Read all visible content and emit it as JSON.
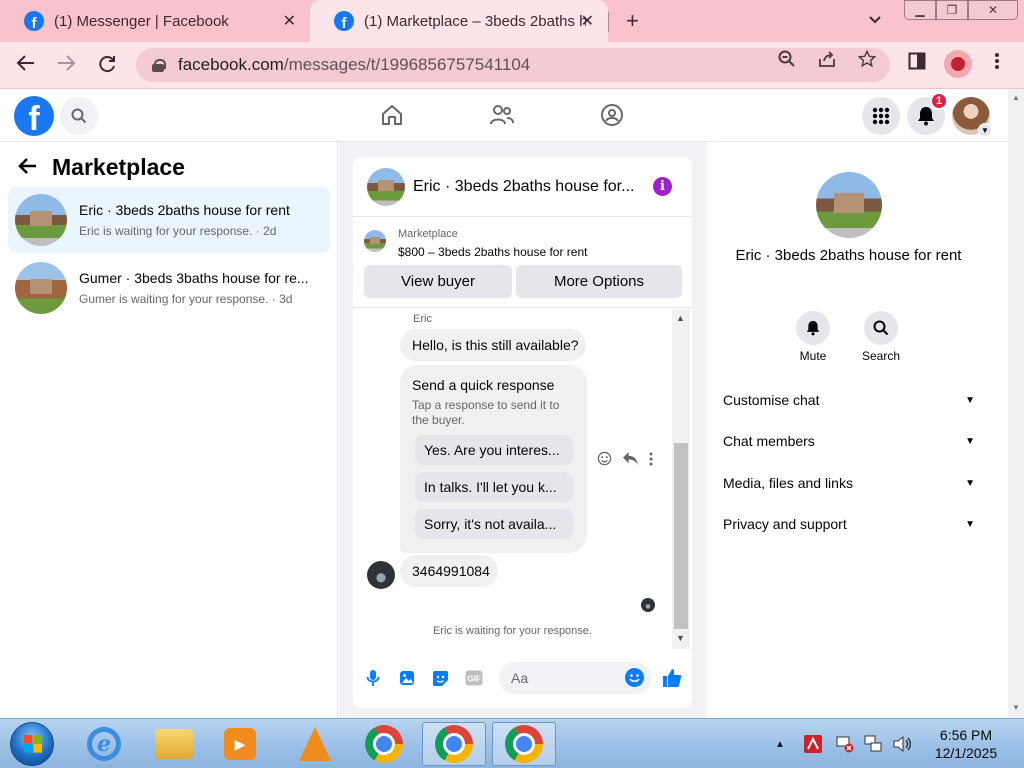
{
  "browser": {
    "tabs": [
      {
        "title": "(1) Messenger | Facebook",
        "close": "✕"
      },
      {
        "title": "(1) Marketplace – 3beds 2baths h",
        "close": "✕"
      }
    ],
    "new_tab": "+",
    "url_domain": "facebook.com",
    "url_path": "/messages/t/1996856757541104"
  },
  "facebook": {
    "logo": "f",
    "notification_count": "1"
  },
  "left": {
    "title": "Marketplace",
    "conversations": [
      {
        "name": "Eric · 3beds 2baths house for rent",
        "sub": "Eric is waiting for your response. · 2d"
      },
      {
        "name": "Gumer · 3beds 3baths house for re...",
        "sub": "Gumer is waiting for your response. · 3d"
      }
    ]
  },
  "chat": {
    "header_name": "Eric · 3beds 2baths house for...",
    "marketplace_label": "Marketplace",
    "listing": "$800 – 3beds 2baths house for rent",
    "view_buyer": "View buyer",
    "more_options": "More Options",
    "sender": "Eric",
    "message1": "Hello, is this still available?",
    "quick_title": "Send a quick response",
    "quick_sub": "Tap a response to send it to the buyer.",
    "quick_replies": [
      "Yes. Are you interes...",
      "In talks. I'll let you k...",
      "Sorry, it's not availa..."
    ],
    "message2": "3464991084",
    "waiting": "Eric is waiting for your response.",
    "input_placeholder": "Aa"
  },
  "right": {
    "name": "Eric · 3beds 2baths house for rent",
    "mute": "Mute",
    "search": "Search",
    "sections": [
      "Customise chat",
      "Chat members",
      "Media, files and links",
      "Privacy and support"
    ]
  },
  "taskbar": {
    "time": "6:56 PM",
    "date": "12/1/2025"
  },
  "colors": {
    "facebook_blue": "#1877f2",
    "messenger_blue": "#0a7cff",
    "info_purple": "#a020d0",
    "badge_red": "#e41e3f",
    "tab_strip": "#f9c2cc"
  }
}
